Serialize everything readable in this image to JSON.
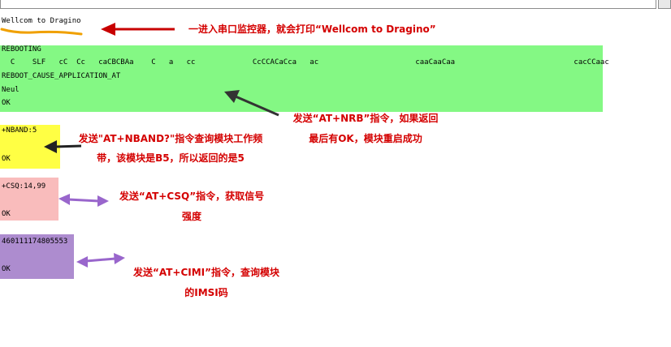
{
  "serial_output": {
    "welcome": "Wellcom to Dragino",
    "reboot_block": {
      "line1": "REBOOTING",
      "line2": "  C    SLF   cC  Cc   caCBCBAa    C   a   cc             CcCCACaCca   ac                      caaCaaCaa                           cacCCaac",
      "line3": "REBOOT_CAUSE_APPLICATION_AT",
      "line4": "Neul",
      "line5": "OK"
    },
    "nband_block": {
      "line1": "+NBAND:5",
      "line2": "OK"
    },
    "csq_block": {
      "line1": "+CSQ:14,99",
      "line2": "OK"
    },
    "cimi_block": {
      "line1": "460111174805553",
      "line2": "OK"
    }
  },
  "annotations": {
    "welcome_note": "一进入串口监控器，就会打印“Wellcom to Dragino”",
    "nrb_note_line1": "发送“AT+NRB”指令，如果返回",
    "nrb_note_line2": "最后有OK，模块重启成功",
    "nband_note_line1": "发送\"AT+NBAND?\"指令查询模块工作频",
    "nband_note_line2": "带，该模块是B5，所以返回的是5",
    "csq_note_line1": "发送“AT+CSQ”指令，获取信号",
    "csq_note_line2": "强度",
    "cimi_note_line1": "发送“AT+CIMI”指令，查询模块",
    "cimi_note_line2": "的IMSI码"
  },
  "colors": {
    "reboot_bg": "#84f884",
    "nband_bg": "#ffff44",
    "csq_bg": "#f9bcbc",
    "cimi_bg": "#ad8ccf",
    "annotation_text": "#d40000",
    "red_arrow": "#c80000",
    "dark_arrow": "#333333",
    "purple_arrow": "#9966cc",
    "underline": "#f0a000"
  }
}
